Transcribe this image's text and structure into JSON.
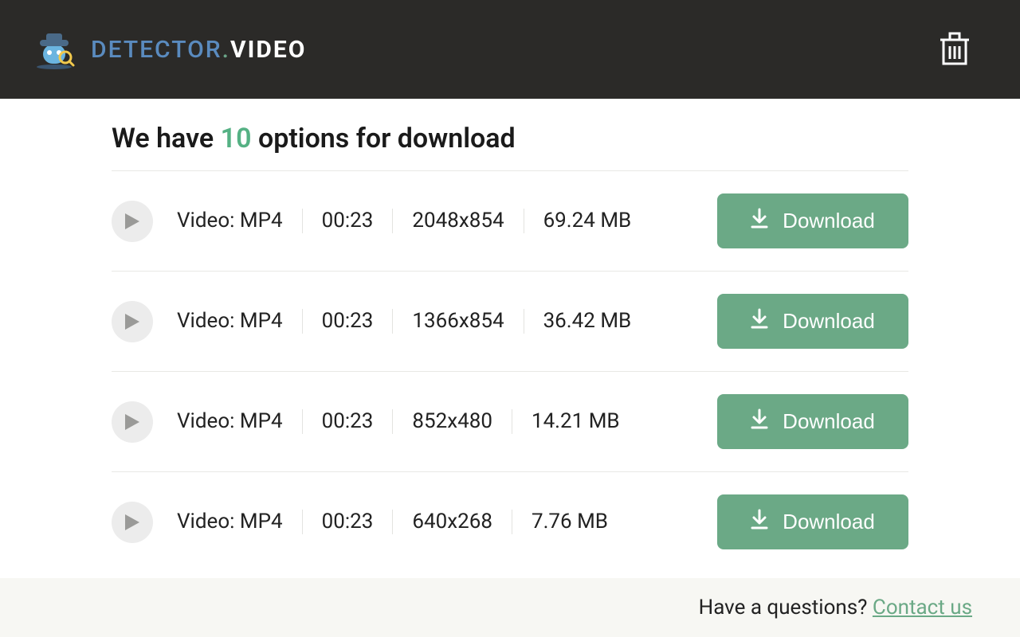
{
  "brand": {
    "part1": "DETECTOR",
    "dot": ".",
    "part2": "VIDEO"
  },
  "heading": {
    "prefix": "We have ",
    "count": "10",
    "suffix": " options for download"
  },
  "rows": [
    {
      "format": "Video: MP4",
      "duration": "00:23",
      "resolution": "2048x854",
      "size": "69.24 MB",
      "button": "Download"
    },
    {
      "format": "Video: MP4",
      "duration": "00:23",
      "resolution": "1366x854",
      "size": "36.42 MB",
      "button": "Download"
    },
    {
      "format": "Video: MP4",
      "duration": "00:23",
      "resolution": "852x480",
      "size": "14.21 MB",
      "button": "Download"
    },
    {
      "format": "Video: MP4",
      "duration": "00:23",
      "resolution": "640x268",
      "size": "7.76 MB",
      "button": "Download"
    }
  ],
  "footer": {
    "question": "Have a questions? ",
    "link": "Contact us"
  }
}
